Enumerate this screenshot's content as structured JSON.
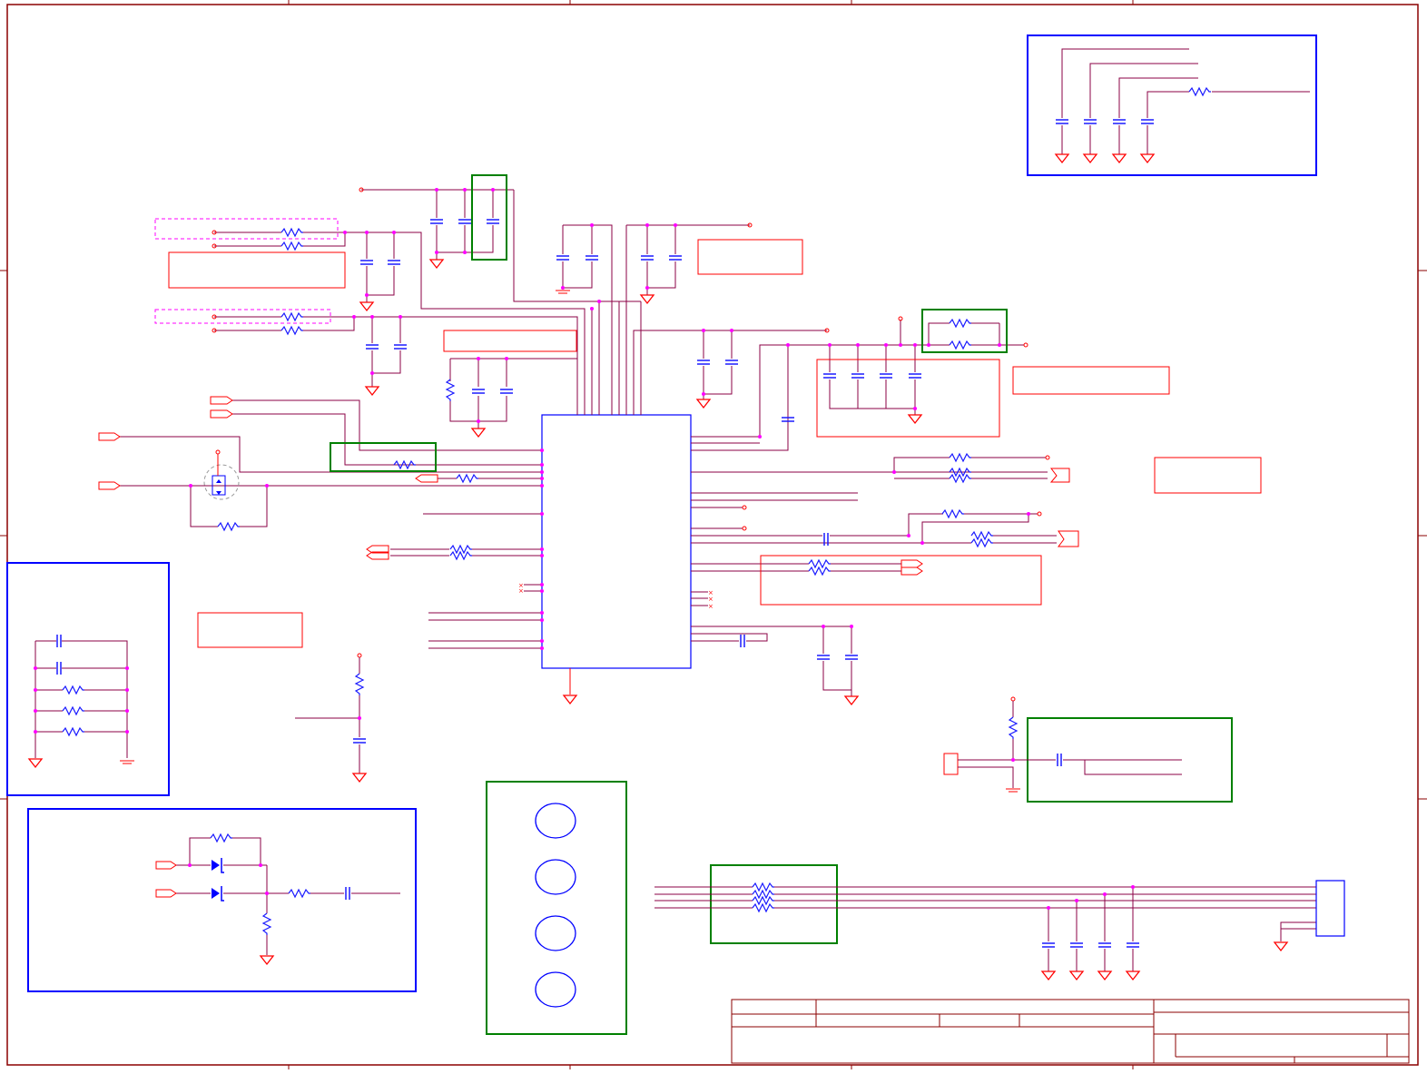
{
  "sheet": {
    "type": "schematic",
    "text_labels": [],
    "colors": {
      "wire": "#8b0046",
      "component": "#ff0000",
      "resistor": "#1a1aff",
      "block_blue": "#0000ff",
      "block_green": "#008000",
      "pin_dot": "#ff00ff",
      "dashed": "#ff00ff",
      "frame": "#8b0000"
    },
    "components": {
      "main_ic": "ic",
      "connector_right": "connector",
      "mounting_holes": "mounting-hole",
      "ground_symbols": "ground",
      "capacitors": "capacitor",
      "resistors": "resistor",
      "diodes": "diode"
    }
  }
}
